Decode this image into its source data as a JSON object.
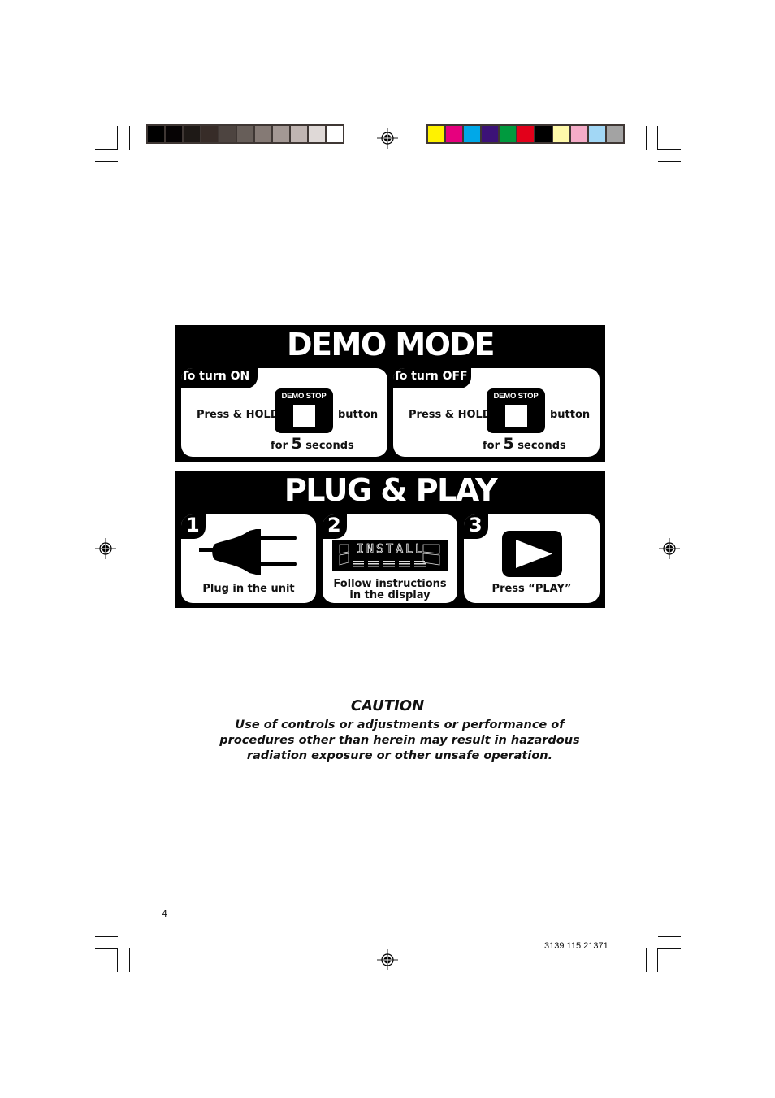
{
  "print_marks": {
    "grayscale_swatches": [
      "#000000",
      "#060304",
      "#1e1916",
      "#372c28",
      "#4d4440",
      "#675e59",
      "#857a75",
      "#a39894",
      "#c0b5b2",
      "#dfd9d7",
      "#ffffff"
    ],
    "color_swatches": [
      "#fff200",
      "#e6007e",
      "#00a8e8",
      "#3c1278",
      "#009a3e",
      "#e2001a",
      "#000000",
      "#fff9aa",
      "#f5acc8",
      "#a2d7f5",
      "#a3a3a3"
    ]
  },
  "demo_mode": {
    "title": "DEMO MODE",
    "turn_on": {
      "tab_label": "To turn ON",
      "press_hold": "Press & HOLD",
      "button_label": "DEMO STOP",
      "button_word": "button",
      "for": "for",
      "seconds_value": "5",
      "seconds_word": "seconds"
    },
    "turn_off": {
      "tab_label": "To turn OFF",
      "press_hold": "Press & HOLD",
      "button_label": "DEMO STOP",
      "button_word": "button",
      "for": "for",
      "seconds_value": "5",
      "seconds_word": "seconds"
    }
  },
  "plug_play": {
    "title": "PLUG & PLAY",
    "steps": [
      {
        "number": "1",
        "icon": "plug-icon",
        "caption": "Plug in the unit"
      },
      {
        "number": "2",
        "icon": "lcd-display",
        "display_text": "INSTALL",
        "caption_line1": "Follow instructions",
        "caption_line2": "in the display"
      },
      {
        "number": "3",
        "icon": "play-icon",
        "caption": "Press “PLAY”"
      }
    ]
  },
  "caution": {
    "title": "CAUTION",
    "lines": [
      "Use of controls or adjustments or performance of",
      "procedures other than herein may result in hazardous",
      "radiation exposure or other unsafe operation."
    ]
  },
  "footer": {
    "page_number": "4",
    "document_code": "3139 115 21371"
  }
}
